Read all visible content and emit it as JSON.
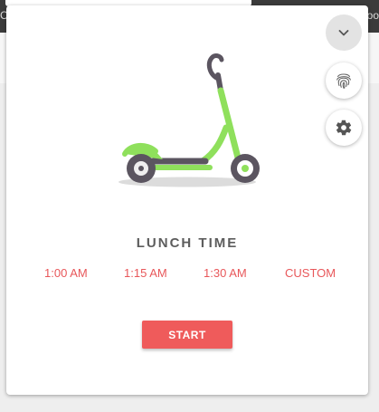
{
  "background": {
    "left_fragment": "C",
    "right_fragment": "oo"
  },
  "popup": {
    "title": "LUNCH TIME",
    "time_options": [
      "1:00 AM",
      "1:15 AM",
      "1:30 AM",
      "CUSTOM"
    ],
    "start_label": "START"
  },
  "side_buttons": {
    "collapse_icon": "chevron-down-icon",
    "fingerprint_icon": "fingerprint-icon",
    "settings_icon": "gear-icon"
  },
  "colors": {
    "accent": "#ef5b5b",
    "option_text": "#e8575a",
    "scooter_green": "#8fe05c",
    "scooter_dark": "#5b5560"
  }
}
